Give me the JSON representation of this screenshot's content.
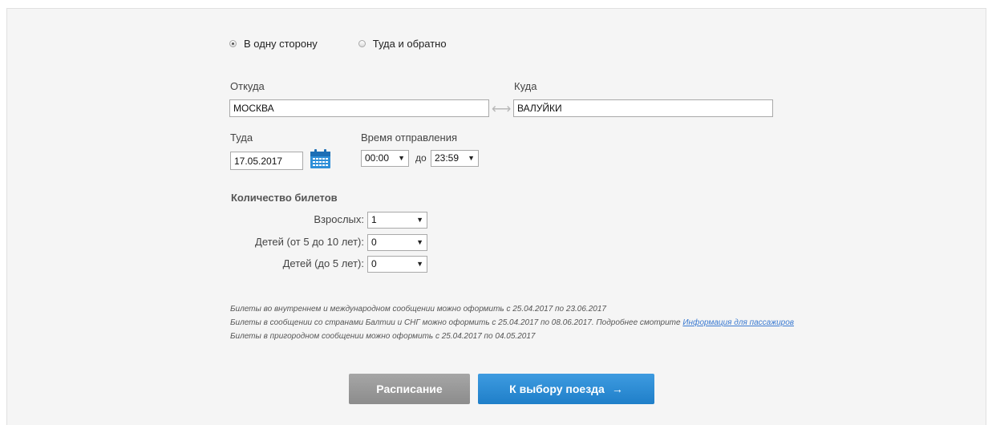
{
  "trip_type": {
    "one_way_label": "В одну сторону",
    "round_trip_label": "Туда и обратно",
    "selected": "one_way"
  },
  "route": {
    "from_label": "Откуда",
    "from_value": "МОСКВА",
    "to_label": "Куда",
    "to_value": "ВАЛУЙКИ",
    "swap_icon": "swap-arrows-icon"
  },
  "date": {
    "label": "Туда",
    "value": "17.05.2017",
    "calendar_icon": "calendar-icon"
  },
  "departure_time": {
    "label": "Время отправления",
    "from_value": "00:00",
    "to_prefix": "до",
    "to_value": "23:59"
  },
  "tickets": {
    "title": "Количество билетов",
    "adults_label": "Взрослых:",
    "adults_value": "1",
    "children_5_10_label": "Детей (от 5 до 10 лет):",
    "children_5_10_value": "0",
    "children_under_5_label": "Детей (до 5 лет):",
    "children_under_5_value": "0"
  },
  "notes": {
    "line1": "Билеты во внутреннем и международном сообщении можно оформить с 25.04.2017 по 23.06.2017",
    "line2": "Билеты в сообщении со странами Балтии и СНГ можно оформить с 25.04.2017 по 08.06.2017. Подробнее смотрите ",
    "line2_link": "Информация для пассажиров",
    "line3": "Билеты в пригородном сообщении можно оформить с 25.04.2017 по 04.05.2017"
  },
  "buttons": {
    "schedule_label": "Расписание",
    "choose_train_label": "К выбору поезда",
    "choose_train_arrow": "→"
  },
  "colors": {
    "panel_bg": "#f5f5f5",
    "primary_button": "#2a8ad4",
    "secondary_button": "#999999",
    "link": "#3b7ad1"
  }
}
